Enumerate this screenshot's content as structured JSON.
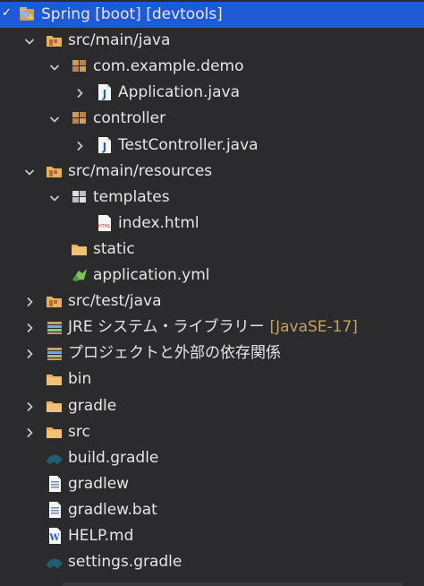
{
  "tree": [
    {
      "label": "Spring [boot] [devtools]",
      "icon": "project-icon",
      "chevron": "down",
      "level": 0,
      "selected": true
    },
    {
      "label": "src/main/java",
      "icon": "source-folder-icon",
      "chevron": "down",
      "level": 1
    },
    {
      "label": "com.example.demo",
      "icon": "package-icon",
      "chevron": "down",
      "level": 2
    },
    {
      "label": "Application.java",
      "icon": "java-file-icon",
      "chevron": "right",
      "level": 3
    },
    {
      "label": "controller",
      "icon": "package-icon",
      "chevron": "down",
      "level": 2
    },
    {
      "label": "TestController.java",
      "icon": "java-file-icon",
      "chevron": "right",
      "level": 3
    },
    {
      "label": "src/main/resources",
      "icon": "source-folder-icon",
      "chevron": "down",
      "level": 1
    },
    {
      "label": "templates",
      "icon": "templates-package-icon",
      "chevron": "down",
      "level": 2
    },
    {
      "label": "index.html",
      "icon": "html-file-icon",
      "chevron": "none",
      "level": 3
    },
    {
      "label": "static",
      "icon": "folder-icon",
      "chevron": "none",
      "level": 2
    },
    {
      "label": "application.yml",
      "icon": "yaml-file-icon",
      "chevron": "none",
      "level": 2
    },
    {
      "label": "src/test/java",
      "icon": "source-folder-icon",
      "chevron": "right",
      "level": 1
    },
    {
      "label": "JRE システム・ライブラリー",
      "suffix": "[JavaSE-17]",
      "icon": "library-icon",
      "chevron": "right",
      "level": 1
    },
    {
      "label": "プロジェクトと外部の依存関係",
      "icon": "library-icon",
      "chevron": "right",
      "level": 1
    },
    {
      "label": "bin",
      "icon": "folder-icon",
      "chevron": "none",
      "level": 1
    },
    {
      "label": "gradle",
      "icon": "folder-icon",
      "chevron": "right",
      "level": 1
    },
    {
      "label": "src",
      "icon": "folder-icon",
      "chevron": "right",
      "level": 1
    },
    {
      "label": "build.gradle",
      "icon": "gradle-icon",
      "chevron": "none",
      "level": 1
    },
    {
      "label": "gradlew",
      "icon": "text-file-icon",
      "chevron": "none",
      "level": 1
    },
    {
      "label": "gradlew.bat",
      "icon": "text-file-icon",
      "chevron": "none",
      "level": 1
    },
    {
      "label": "HELP.md",
      "icon": "markdown-file-icon",
      "chevron": "none",
      "level": 1
    },
    {
      "label": "settings.gradle",
      "icon": "gradle-icon",
      "chevron": "none",
      "level": 1
    }
  ],
  "colors": {
    "background": "#2b2b2d",
    "selection": "#1f5ad6",
    "suffix": "#c7a35a"
  }
}
